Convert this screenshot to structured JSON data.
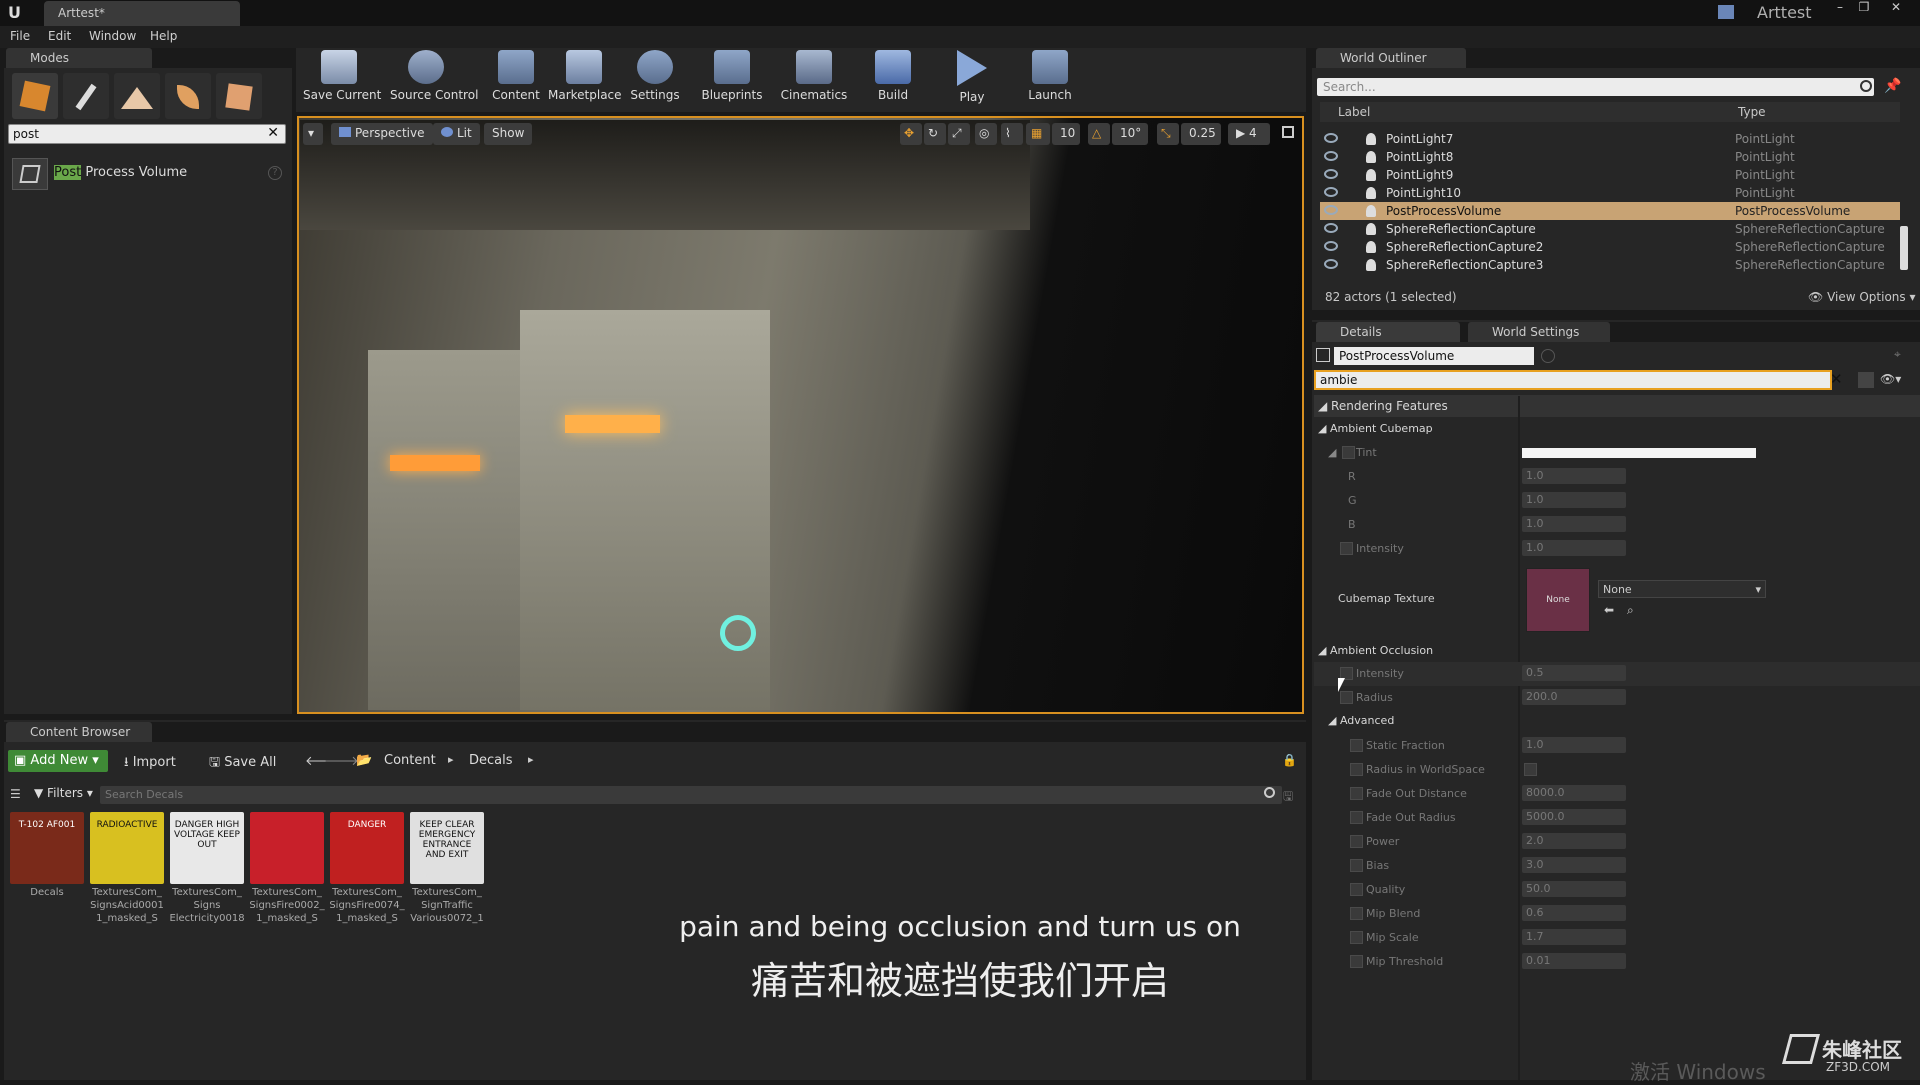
{
  "title": {
    "doc_tab": "Arttest*",
    "app_name": "Arttest"
  },
  "menu": [
    "File",
    "Edit",
    "Window",
    "Help"
  ],
  "modes": {
    "tab": "Modes",
    "search_value": "post",
    "result_highlight": "Post",
    "result_rest": " Process Volume"
  },
  "toolbar": [
    {
      "label": "Save Current"
    },
    {
      "label": "Source Control"
    },
    {
      "label": "Content"
    },
    {
      "label": "Marketplace"
    },
    {
      "label": "Settings"
    },
    {
      "label": "Blueprints"
    },
    {
      "label": "Cinematics"
    },
    {
      "label": "Build"
    },
    {
      "label": "Play"
    },
    {
      "label": "Launch"
    }
  ],
  "viewport": {
    "perspective": "Perspective",
    "lit": "Lit",
    "show": "Show",
    "grid_snap": "10",
    "rot_snap": "10°",
    "scale_snap": "0.25",
    "cam_speed": "4"
  },
  "outliner": {
    "tab": "World Outliner",
    "search_placeholder": "Search...",
    "col_label": "Label",
    "col_type": "Type",
    "rows": [
      {
        "name": "PointLight7",
        "type": "PointLight"
      },
      {
        "name": "PointLight8",
        "type": "PointLight"
      },
      {
        "name": "PointLight9",
        "type": "PointLight"
      },
      {
        "name": "PointLight10",
        "type": "PointLight"
      },
      {
        "name": "PostProcessVolume",
        "type": "PostProcessVolume",
        "selected": true
      },
      {
        "name": "SphereReflectionCapture",
        "type": "SphereReflectionCapture"
      },
      {
        "name": "SphereReflectionCapture2",
        "type": "SphereReflectionCapture"
      },
      {
        "name": "SphereReflectionCapture3",
        "type": "SphereReflectionCapture"
      }
    ],
    "status": "82 actors (1 selected)",
    "view_options": "View Options"
  },
  "details": {
    "tab_details": "Details",
    "tab_world": "World Settings",
    "object_name": "PostProcessVolume",
    "search_value": "ambie",
    "rendering_features": "Rendering Features",
    "ambient_cubemap": "Ambient Cubemap",
    "tint": "Tint",
    "r_label": "R",
    "r_val": "1.0",
    "g_label": "G",
    "g_val": "1.0",
    "b_label": "B",
    "b_val": "1.0",
    "intensity_label": "Intensity",
    "intensity_val": "1.0",
    "cubemap_texture": "Cubemap Texture",
    "cubemap_thumb": "None",
    "cubemap_select": "None",
    "ambient_occlusion": "Ambient Occlusion",
    "ao_rows": [
      {
        "label": "Intensity",
        "value": "0.5"
      },
      {
        "label": "Radius",
        "value": "200.0"
      }
    ],
    "advanced": "Advanced",
    "adv_rows": [
      {
        "label": "Static Fraction",
        "value": "1.0"
      },
      {
        "label": "Radius in WorldSpace",
        "value": ""
      },
      {
        "label": "Fade Out Distance",
        "value": "8000.0"
      },
      {
        "label": "Fade Out Radius",
        "value": "5000.0"
      },
      {
        "label": "Power",
        "value": "2.0"
      },
      {
        "label": "Bias",
        "value": "3.0"
      },
      {
        "label": "Quality",
        "value": "50.0"
      },
      {
        "label": "Mip Blend",
        "value": "0.6"
      },
      {
        "label": "Mip Scale",
        "value": "1.7"
      },
      {
        "label": "Mip Threshold",
        "value": "0.01"
      }
    ]
  },
  "content_browser": {
    "tab": "Content Browser",
    "add_new": "Add New",
    "import": "Import",
    "save_all": "Save All",
    "crumb1": "Content",
    "crumb2": "Decals",
    "filters": "Filters",
    "search_placeholder": "Search Decals",
    "assets": [
      {
        "line1": "Decals",
        "line2": "",
        "line3": "",
        "color": "#7a2a1a",
        "thumb": "T-102 AF001"
      },
      {
        "line1": "TexturesCom_",
        "line2": "SignsAcid0001",
        "line3": "1_masked_S",
        "color": "#d8c020",
        "thumb": "RADIOACTIVE"
      },
      {
        "line1": "TexturesCom_",
        "line2": "Signs",
        "line3": "Electricity0018",
        "color": "#e8e8e8",
        "thumb": "DANGER HIGH VOLTAGE KEEP OUT"
      },
      {
        "line1": "TexturesCom_",
        "line2": "SignsFire0002_",
        "line3": "1_masked_S",
        "color": "#c8202a",
        "thumb": ""
      },
      {
        "line1": "TexturesCom_",
        "line2": "SignsFire0074_",
        "line3": "1_masked_S",
        "color": "#c02020",
        "thumb": "DANGER"
      },
      {
        "line1": "TexturesCom_",
        "line2": "SignTraffic",
        "line3": "Various0072_1",
        "color": "#e0e0e0",
        "thumb": "KEEP CLEAR EMERGENCY ENTRANCE AND EXIT"
      }
    ]
  },
  "subtitles": {
    "en": "pain and being occlusion and turn us on",
    "cn": "痛苦和被遮挡使我们开启"
  },
  "watermark": {
    "windows": "激活 Windows",
    "brand": "朱峰社区",
    "brand_sub": "ZF3D.COM"
  }
}
